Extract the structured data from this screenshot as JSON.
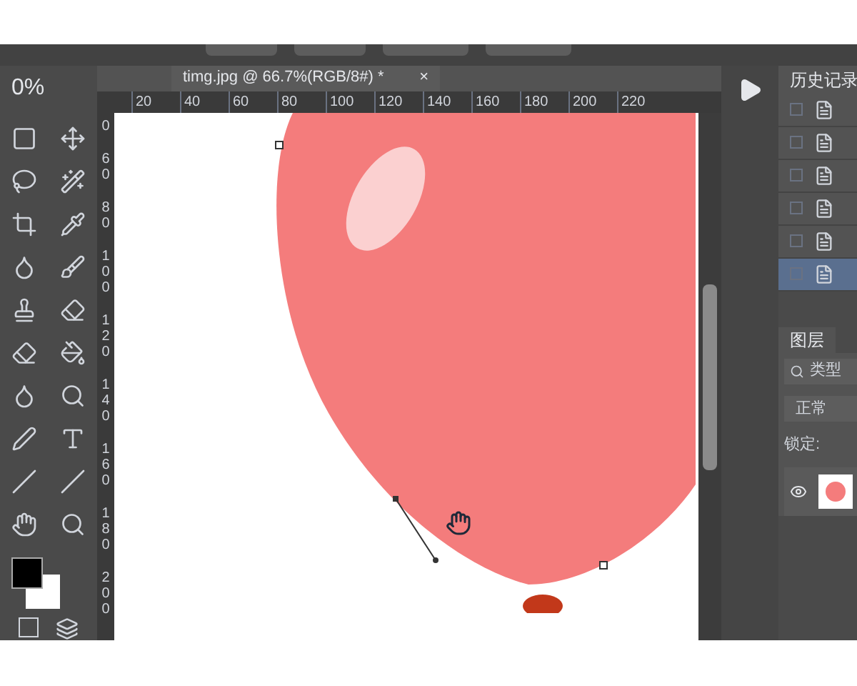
{
  "tool_options": {
    "opacity": "0%"
  },
  "document_tab": {
    "title": "timg.jpg @ 66.7%(RGB/8#) *",
    "close": "×"
  },
  "ruler": {
    "x_labels": [
      "20",
      "40",
      "60",
      "80",
      "100",
      "120",
      "140",
      "160",
      "180",
      "200",
      "220"
    ],
    "y_labels": [
      "0",
      "60",
      "80",
      "100",
      "120",
      "140",
      "160",
      "180",
      "200"
    ]
  },
  "history": {
    "title": "历史记录",
    "steps": [
      {
        "selected": false
      },
      {
        "selected": false
      },
      {
        "selected": false
      },
      {
        "selected": false
      },
      {
        "selected": false
      },
      {
        "selected": true
      }
    ]
  },
  "layers": {
    "tabs": [
      {
        "label": "图层",
        "selected": true
      }
    ],
    "filter": "类型",
    "blend_mode": "正常",
    "lock_label": "锁定:"
  }
}
